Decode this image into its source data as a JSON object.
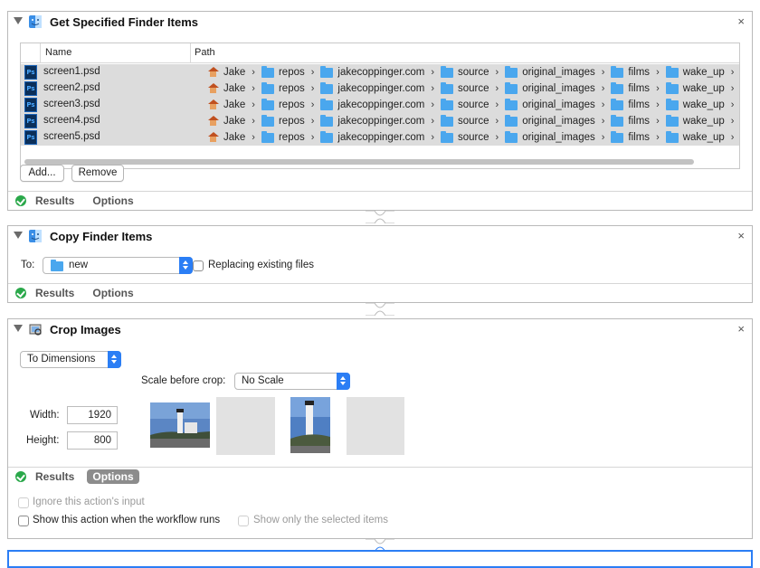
{
  "action1": {
    "title": "Get Specified Finder Items",
    "close": "×",
    "table": {
      "headers": [
        "Name",
        "Path"
      ],
      "rows": [
        {
          "name": "screen1.psd"
        },
        {
          "name": "screen2.psd"
        },
        {
          "name": "screen3.psd"
        },
        {
          "name": "screen4.psd"
        },
        {
          "name": "screen5.psd"
        }
      ],
      "path_segments": [
        "Jake",
        "repos",
        "jakecoppinger.com",
        "source",
        "original_images",
        "films",
        "wake_up"
      ],
      "ps_badge": "Ps"
    },
    "add_label": "Add...",
    "remove_label": "Remove",
    "results_label": "Results",
    "options_label": "Options"
  },
  "action2": {
    "title": "Copy Finder Items",
    "close": "×",
    "to_label": "To:",
    "to_value": "new",
    "replace_label": "Replacing existing files",
    "results_label": "Results",
    "options_label": "Options"
  },
  "action3": {
    "title": "Crop Images",
    "close": "×",
    "mode_value": "To Dimensions",
    "scale_label": "Scale before crop:",
    "scale_value": "No Scale",
    "width_label": "Width:",
    "width_value": "1920",
    "height_label": "Height:",
    "height_value": "800",
    "results_label": "Results",
    "options_label": "Options",
    "ignore_input_label": "Ignore this action's input",
    "show_action_label": "Show this action when the workflow runs",
    "show_selected_label": "Show only the selected items"
  },
  "colors": {
    "check_green": "#2aa84a",
    "select_blue": "#2b7ef5",
    "folder_blue": "#4aa7ee",
    "row_gray": "#dcdcdc"
  },
  "icons": {
    "collapse": "disclosure-triangle-icon",
    "finder": "finder-icon",
    "preview": "preview-app-icon",
    "ps_file": "photoshop-file-icon",
    "home": "home-folder-icon",
    "folder": "folder-icon",
    "close": "close-icon"
  }
}
